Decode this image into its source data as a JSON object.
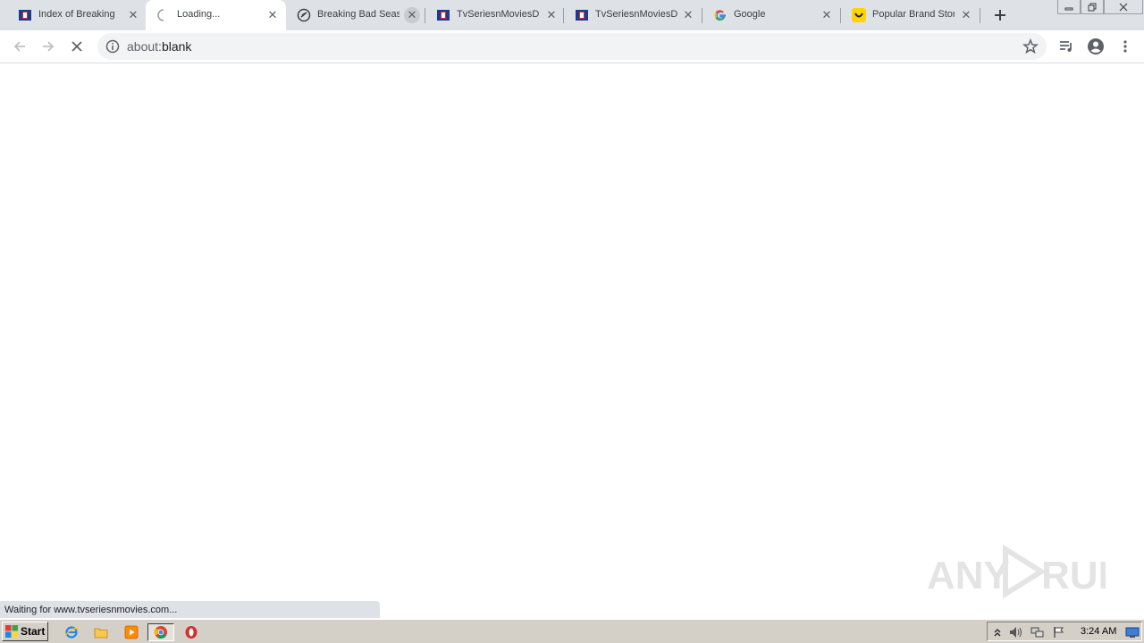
{
  "browser": {
    "tabs": [
      {
        "title": "Index of Breaking B",
        "favicon": "tvseries-icon",
        "active": false
      },
      {
        "title": "Loading...",
        "favicon": "loading-spinner-icon",
        "active": true
      },
      {
        "title": "Breaking Bad Seaso",
        "favicon": "shield-icon",
        "active": false
      },
      {
        "title": "TvSeriesnMoviesDL",
        "favicon": "tvseries-icon",
        "active": false
      },
      {
        "title": "TvSeriesnMoviesDL",
        "favicon": "tvseries-icon",
        "active": false
      },
      {
        "title": "Google",
        "favicon": "google-icon",
        "active": false
      },
      {
        "title": "Popular Brand Store",
        "favicon": "smile-icon",
        "active": false
      }
    ],
    "new_tab_icon": "plus-icon",
    "window_controls": [
      "minimize-icon",
      "restore-icon",
      "close-icon"
    ],
    "address": {
      "scheme": "about:",
      "rest": "blank"
    },
    "status_text": "Waiting for www.tvseriesnmovies.com...",
    "watermark_text": "ANY RUN"
  },
  "taskbar": {
    "start_label": "Start",
    "quick_launch": [
      "ie-icon",
      "explorer-icon",
      "media-player-icon",
      "chrome-icon",
      "opera-icon"
    ],
    "tray_icons": [
      "tray-expand-icon",
      "speaker-icon",
      "network-icon",
      "flag-icon"
    ],
    "clock": "3:24 AM"
  },
  "colors": {
    "tabstrip_bg": "#dee1e6",
    "omnibox_bg": "#f1f3f4",
    "taskbar_bg": "#d4d0c8"
  }
}
